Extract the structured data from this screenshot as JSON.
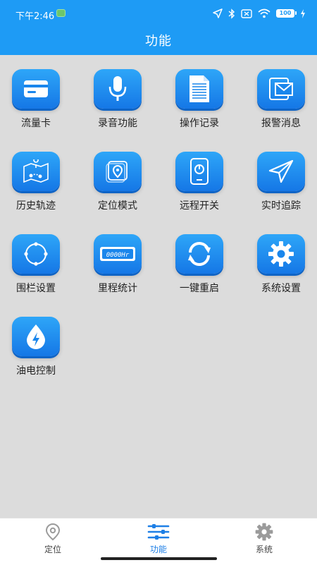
{
  "status_bar": {
    "time": "下午2:46",
    "battery": "100"
  },
  "header": {
    "title": "功能"
  },
  "functions": [
    {
      "label": "流量卡",
      "icon": "sim-card-icon"
    },
    {
      "label": "录音功能",
      "icon": "microphone-icon"
    },
    {
      "label": "操作记录",
      "icon": "document-icon"
    },
    {
      "label": "报警消息",
      "icon": "mail-alert-icon"
    },
    {
      "label": "历史轨迹",
      "icon": "route-icon"
    },
    {
      "label": "定位模式",
      "icon": "location-pin-icon"
    },
    {
      "label": "远程开关",
      "icon": "power-switch-icon"
    },
    {
      "label": "实时追踪",
      "icon": "paper-plane-icon"
    },
    {
      "label": "围栏设置",
      "icon": "fence-circle-icon"
    },
    {
      "label": "里程统计",
      "icon": "odometer-icon"
    },
    {
      "label": "一键重启",
      "icon": "restart-icon"
    },
    {
      "label": "系统设置",
      "icon": "gear-icon"
    },
    {
      "label": "油电控制",
      "icon": "power-drop-icon"
    }
  ],
  "odometer_text": "0000Hr",
  "bottom_nav": [
    {
      "label": "定位",
      "icon": "location-icon",
      "active": false
    },
    {
      "label": "功能",
      "icon": "sliders-icon",
      "active": true
    },
    {
      "label": "系统",
      "icon": "settings-icon",
      "active": false
    }
  ],
  "colors": {
    "header": "#1e9bf5",
    "tile_top": "#2ea6f8",
    "tile_bottom": "#1577e6",
    "active_tab": "#1e7fe6",
    "background": "#dcdcdc"
  }
}
